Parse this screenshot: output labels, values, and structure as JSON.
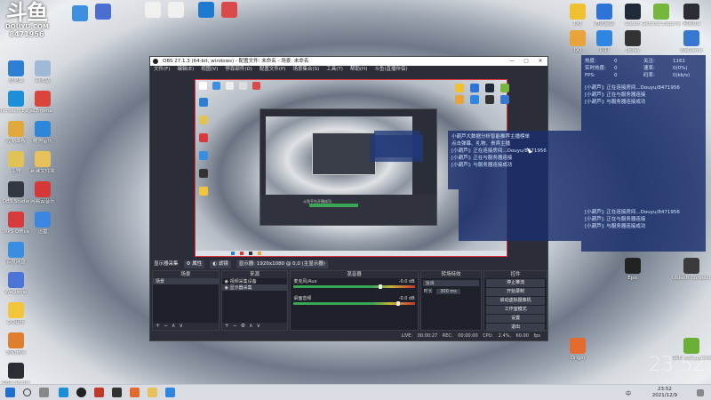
{
  "brand": {
    "logo_text": "斗鱼",
    "site": "DOUYU.COM",
    "room_id": "8471956"
  },
  "desktop_icons_left": [
    {
      "label": "此电脑",
      "color": "#2d7fd6"
    },
    {
      "label": "Microsoft Edge",
      "color": "#1b8fd8"
    },
    {
      "label": "控制面板",
      "color": "#e1a93c"
    },
    {
      "label": "工作",
      "color": "#e0c255"
    },
    {
      "label": "OBS Studio",
      "color": "#333740"
    },
    {
      "label": "WPS Office",
      "color": "#d63a3a"
    },
    {
      "label": "百度网盘",
      "color": "#3a8ee0"
    },
    {
      "label": "WeGame",
      "color": "#4a74d8"
    },
    {
      "label": "QQ音乐",
      "color": "#f2c53a"
    },
    {
      "label": "驱动精灵",
      "color": "#de7e2e"
    },
    {
      "label": "OBS Studio",
      "color": "#2a2d34"
    }
  ],
  "desktop_icons_col2": [
    {
      "label": "回收站",
      "color": "#9fb8d6"
    },
    {
      "label": "Chrome",
      "color": "#d9453a"
    },
    {
      "label": "酷狗音乐",
      "color": "#2d86d8"
    },
    {
      "label": "新建文件夹",
      "color": "#e7c25a"
    },
    {
      "label": "网易云音乐",
      "color": "#d63838"
    },
    {
      "label": "迅雷",
      "color": "#3a86e0"
    }
  ],
  "desktop_icons_top": [
    {
      "label": "",
      "color": "#3d8fe0"
    },
    {
      "label": "",
      "color": "#4a6fd0"
    },
    {
      "label": "",
      "color": "#f0f0f0"
    },
    {
      "label": "",
      "color": "#f0f0f0"
    },
    {
      "label": "",
      "color": "#1e7ad0"
    },
    {
      "label": "",
      "color": "#d94b4b"
    }
  ],
  "desktop_icons_right": [
    {
      "label": "QQ",
      "color": "#f0c030"
    },
    {
      "label": "腾讯会议",
      "color": "#2e73d8"
    },
    {
      "label": "Steam",
      "color": "#1f2a38"
    },
    {
      "label": "Geforce Experience",
      "color": "#74b73a"
    },
    {
      "label": "网易UU",
      "color": "#2a2d33"
    },
    {
      "label": "QQ",
      "color": "#e8a33a"
    },
    {
      "label": "钉钉",
      "color": "#2f86e0"
    },
    {
      "label": "Uplay",
      "color": "#333"
    },
    {
      "label": "WeGame",
      "color": "#3877d0"
    },
    {
      "label": "Epic",
      "color": "#222"
    },
    {
      "label": "Ubisoft Connect",
      "color": "#3b3b3b"
    },
    {
      "label": "Origin",
      "color": "#e36b2e"
    },
    {
      "label": "GeForce Experience",
      "color": "#6ab036"
    }
  ],
  "obs": {
    "title": "OBS 27.1.3 (64-bit, windows) - 配置文件: 未命名 - 场景: 未命名",
    "menu": [
      "文件(F)",
      "编辑(E)",
      "视图(V)",
      "停靠部件(D)",
      "配置文件(P)",
      "场景集合(S)",
      "工具(T)",
      "帮助(H)",
      "斗鱼(直播伴侣)"
    ],
    "source_bar": {
      "source": "显示器采集",
      "props": "属性",
      "filters": "滤镜",
      "display_label": "显示器: 1920x1080 @ 0,0 (主显示器)"
    },
    "docks": {
      "scenes": {
        "title": "场景",
        "items": [
          "场景"
        ]
      },
      "sources": {
        "title": "来源",
        "items": [
          "视频采集设备",
          "显示器采集"
        ]
      },
      "mixer": {
        "title": "混音器",
        "ch1": "麦克风/Aux",
        "ch1_db": "-0.0 dB",
        "ch2": "桌面音频",
        "ch2_db": "-0.0 dB",
        "ch1_level": 0.7,
        "ch2_level": 0.85
      },
      "transitions": {
        "title": "转场特效",
        "type": "淡出",
        "duration_label": "时长",
        "duration": "300 ms"
      },
      "controls": {
        "title": "控件",
        "buttons": [
          "停止推流",
          "开始录制",
          "启动虚拟摄像机",
          "工作室模式",
          "设置",
          "退出"
        ]
      }
    },
    "status": {
      "live": "LIVE: 00:00:27",
      "rec": "REC: 00:00:00",
      "cpu": "CPU: 2.4%, 60.00 fps"
    }
  },
  "overlay_top": {
    "stats": [
      {
        "k": "热度:",
        "v": "0"
      },
      {
        "k": "关注:",
        "v": "1161"
      },
      {
        "k": "实时热度:",
        "v": "0"
      },
      {
        "k": "速率:",
        "v": "0(0%)"
      },
      {
        "k": "FPS:",
        "v": "0"
      },
      {
        "k": "码率:",
        "v": "0(kb/s)"
      }
    ],
    "lines": [
      "[小葫芦]: 正在连接房间...Douyu/8471956",
      "[小葫芦]: 正在与服务器连接",
      "[小葫芦]: 与服务器连接成功"
    ]
  },
  "overlay_mid": {
    "lines": [
      "小葫芦大数据分析智能推荐主播榜单",
      "点击弹幕、礼物、贵宾主播",
      "[小葫芦]: 正在连接房间...Douyu/8471956",
      "[小葫芦]: 正在与服务器连接",
      "[小葫芦]: 与服务器连接成功"
    ]
  },
  "overlay_bottom": {
    "lines": [
      "[小葫芦]: 正在连接房间...Douyu/8471956",
      "[小葫芦]: 正在与服务器连接",
      "[小葫芦]: 与服务器连接成功"
    ]
  },
  "inner_preview": {
    "status": "斗鱼平台开播成功"
  },
  "taskbar": {
    "time": "23:52",
    "date": "2021/12/9",
    "lang": "中",
    "watermark_clock": "23:52"
  }
}
